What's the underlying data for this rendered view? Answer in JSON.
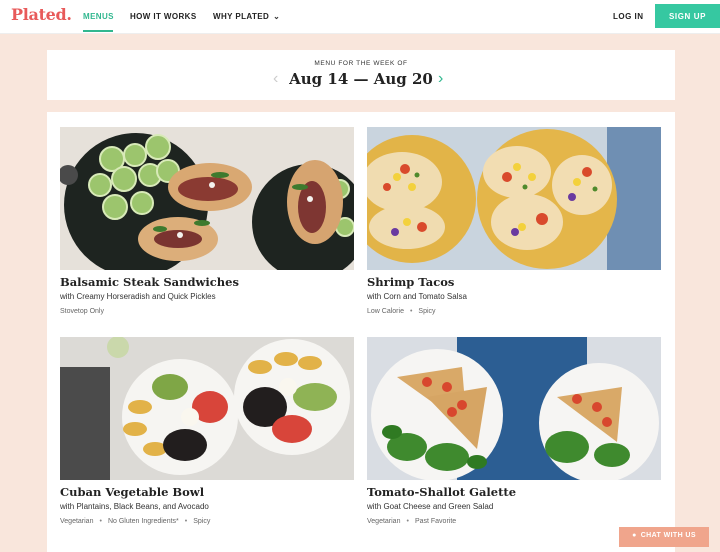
{
  "brand": {
    "logo": "Plated."
  },
  "nav": {
    "items": [
      "MENUS",
      "HOW IT WORKS",
      "WHY PLATED"
    ],
    "chevron": "chevron-down-icon",
    "login": "LOG IN",
    "signup": "SIGN UP",
    "accent": "#31b78f",
    "signup_color": "#36c8a1",
    "logo_color": "#e85a5a"
  },
  "week": {
    "label": "MENU FOR THE WEEK OF",
    "range": "Aug 14 — Aug 20",
    "prev_icon": "chevron-left-icon",
    "next_icon": "chevron-right-icon"
  },
  "recipes": [
    {
      "title": "Balsamic Steak Sandwiches",
      "subtitle": "with Creamy Horseradish and Quick Pickles",
      "tags": [
        "Stovetop Only"
      ]
    },
    {
      "title": "Shrimp Tacos",
      "subtitle": "with Corn and Tomato Salsa",
      "tags": [
        "Low Calorie",
        "Spicy"
      ]
    },
    {
      "title": "Cuban Vegetable Bowl",
      "subtitle": "with Plantains, Black Beans, and Avocado",
      "tags": [
        "Vegetarian",
        "No Gluten Ingredients*",
        "Spicy"
      ]
    },
    {
      "title": "Tomato-Shallot Galette",
      "subtitle": "with Goat Cheese and Green Salad",
      "tags": [
        "Vegetarian",
        "Past Favorite"
      ]
    }
  ],
  "chat": {
    "label": "CHAT WITH US",
    "icon": "chat-bubble-icon"
  },
  "page_background": "#f9e6dc"
}
